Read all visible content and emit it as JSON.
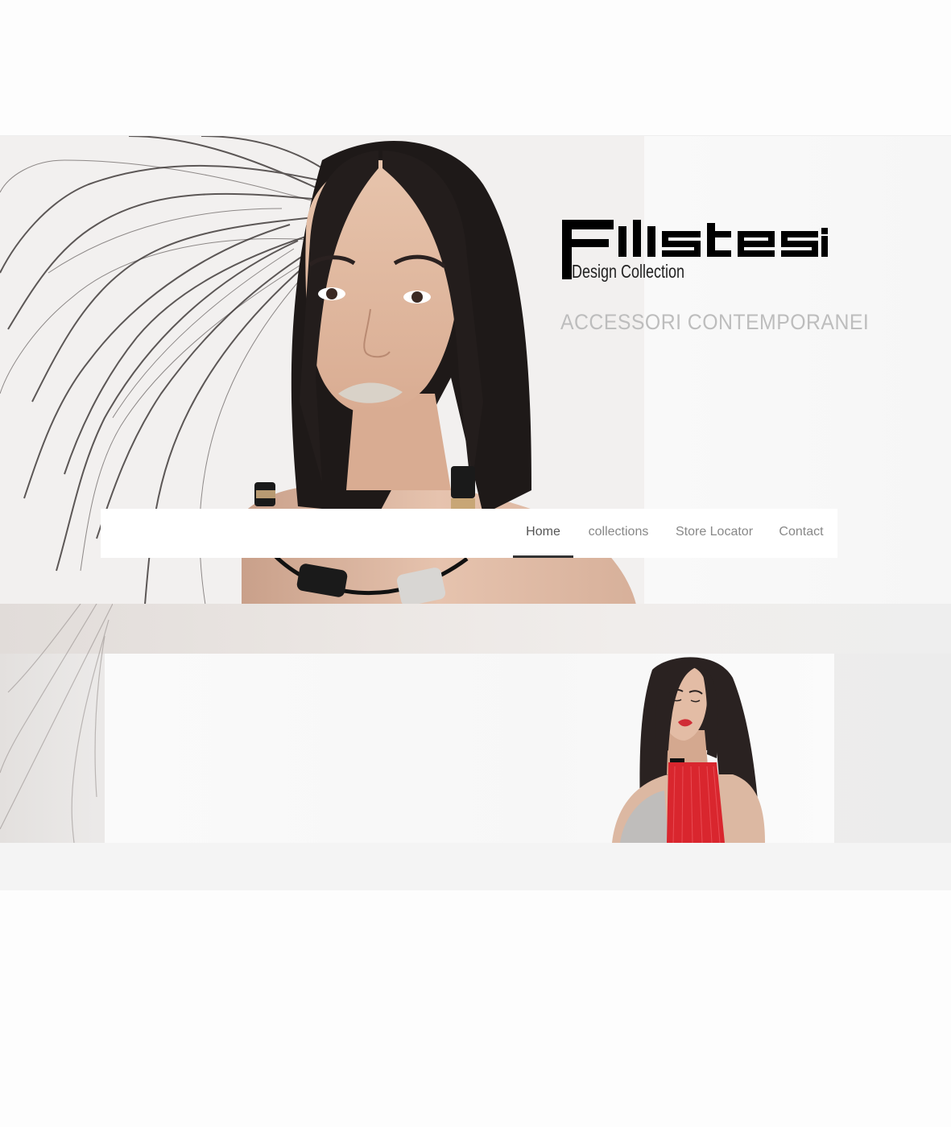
{
  "brand": {
    "logo_text": "Filistesi",
    "logo_subtitle": "Design Collection",
    "tagline": "ACCESSORI CONTEMPORANEI"
  },
  "nav": {
    "items": [
      {
        "label": "Home",
        "active": true
      },
      {
        "label": "collections",
        "active": false
      },
      {
        "label": "Store Locator",
        "active": false
      },
      {
        "label": "Contact",
        "active": false
      }
    ]
  },
  "colors": {
    "background": "#fdfdfd",
    "nav_background": "#ffffff",
    "nav_active_underline": "#333333",
    "nav_text": "#888888",
    "tagline": "#bdbdbd",
    "accent_red": "#d9262e"
  },
  "images": {
    "hero": "model-portrait-with-necklace",
    "card": "model-with-red-fringe-necklace"
  }
}
